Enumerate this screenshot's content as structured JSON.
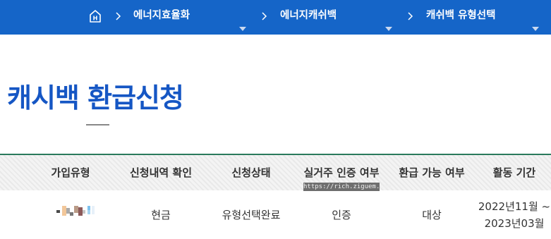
{
  "nav": {
    "home_label": "H",
    "crumbs": [
      {
        "label": "에너지효율화"
      },
      {
        "label": "에너지캐쉬백"
      },
      {
        "label": "캐쉬백 유형선택"
      }
    ]
  },
  "page": {
    "title": "캐시백 환급신청"
  },
  "table": {
    "headers": [
      "가입유형",
      "신청내역 확인",
      "신청상태",
      "실거주 인증 여부",
      "환급 가능 여부",
      "활동 기간"
    ],
    "row": {
      "type": "",
      "history": "현금",
      "status": "유형선택완료",
      "residence": "인증",
      "eligible": "대상",
      "period_line1": "2022년11월 ~",
      "period_line2": "2023년03월"
    }
  },
  "watermark": "https://rich.ziguem.com",
  "colors": {
    "topbar": "#1565c8",
    "title": "#1556c4",
    "table_top_border": "#2a7a5c"
  }
}
